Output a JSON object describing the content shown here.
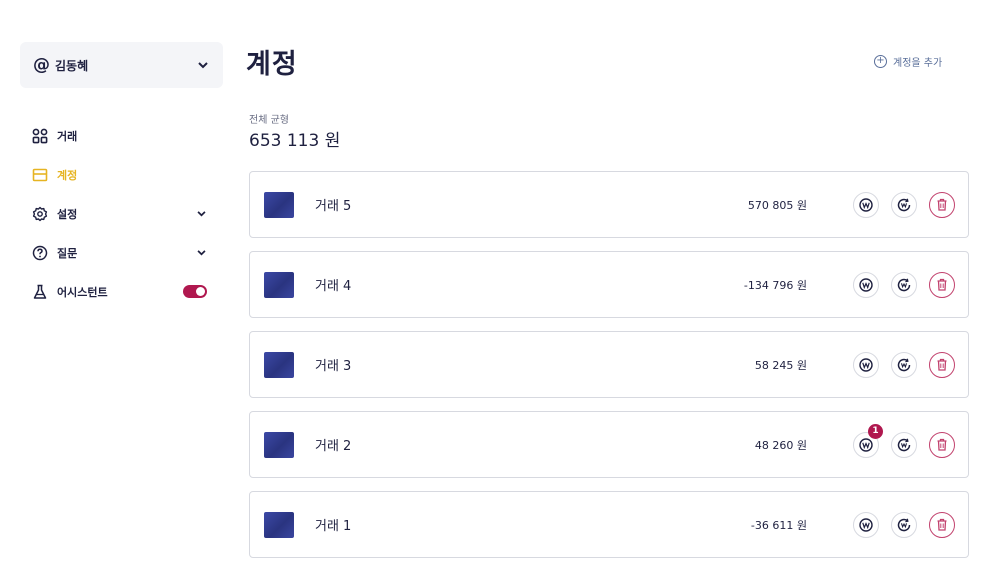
{
  "user": {
    "at_symbol": "@",
    "name": "김동혜"
  },
  "nav": {
    "items": [
      {
        "label": "거래",
        "icon": "grid-icon"
      },
      {
        "label": "계정",
        "icon": "account-card-icon",
        "active": true
      },
      {
        "label": "설정",
        "icon": "gear-icon",
        "expandable": true
      },
      {
        "label": "질문",
        "icon": "question-icon",
        "expandable": true
      },
      {
        "label": "어시스턴트",
        "icon": "flask-icon",
        "toggle": true
      }
    ]
  },
  "main": {
    "title": "계정",
    "add_account": {
      "icon": "plus-circle-icon",
      "label": "계정을 추가"
    },
    "balance": {
      "label": "전체 균형",
      "value": "653 113 원"
    },
    "accounts": [
      {
        "name": "거래 5",
        "amount": "570 805 원",
        "badge": ""
      },
      {
        "name": "거래 4",
        "amount": "-134 796 원",
        "badge": ""
      },
      {
        "name": "거래 3",
        "amount": "58 245 원",
        "badge": ""
      },
      {
        "name": "거래 2",
        "amount": "48 260 원",
        "badge": "1"
      },
      {
        "name": "거래 1",
        "amount": "-36 611 원",
        "badge": ""
      }
    ]
  },
  "colors": {
    "primary": "#1f2140",
    "active": "#e6b422",
    "danger": "#b0184f",
    "accent_link": "#5a6f9a"
  },
  "icons": {
    "won": "won-icon",
    "transfer": "won-refresh-icon",
    "delete": "trash-icon"
  }
}
